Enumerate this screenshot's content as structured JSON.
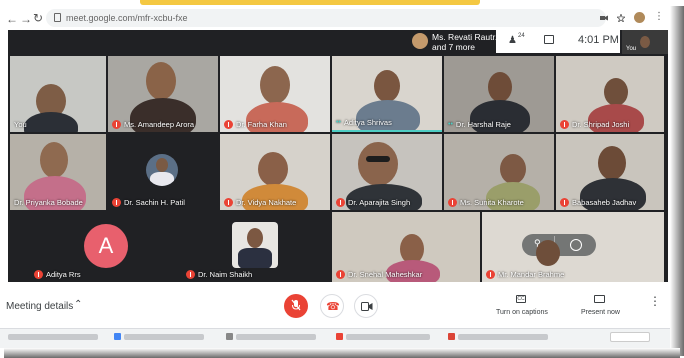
{
  "browser": {
    "back_icon": "arrow-left-icon",
    "forward_icon": "arrow-right-icon",
    "reload_icon": "reload-icon",
    "url": "meet.google.com/mfr-xcbu-fxe"
  },
  "meet_header": {
    "presenter_name": "Ms. Revati Rautr...",
    "presenter_more": "and 7 more",
    "people_count": "24",
    "time": "4:01 PM",
    "self_label": "You"
  },
  "tiles": [
    {
      "name": "You"
    },
    {
      "name": "Ms. Amandeep Arora"
    },
    {
      "name": "Dr. Farha Khan"
    },
    {
      "name": "Aditya Shrivas"
    },
    {
      "name": "Dr. Harshal Raje"
    },
    {
      "name": "Dr. Shripad Joshi"
    },
    {
      "name": "Dr. Priyanka Bobade"
    },
    {
      "name": "Dr. Sachin H. Patil"
    },
    {
      "name": "Dr. Vidya Nakhate"
    },
    {
      "name": "Dr. Aparajita Singh"
    },
    {
      "name": "Ms. Sunita Kharote"
    },
    {
      "name": "Babasaheb Jadhav"
    },
    {
      "name": "Aditya Rrs",
      "avatar_letter": "A"
    },
    {
      "name": "Dr. Naim Shaikh"
    },
    {
      "name": "Dr. Snehal Maheshkar"
    },
    {
      "name": "Mr. Mandar Brahme"
    }
  ],
  "bottom_bar": {
    "meeting_details": "Meeting details",
    "captions_label": "Turn on captions",
    "captions_icon_text": "CC",
    "present_label": "Present now"
  },
  "colors": {
    "meet_bg": "#202124",
    "mute_red": "#ea4335",
    "avatar_pink": "#e8606d"
  }
}
